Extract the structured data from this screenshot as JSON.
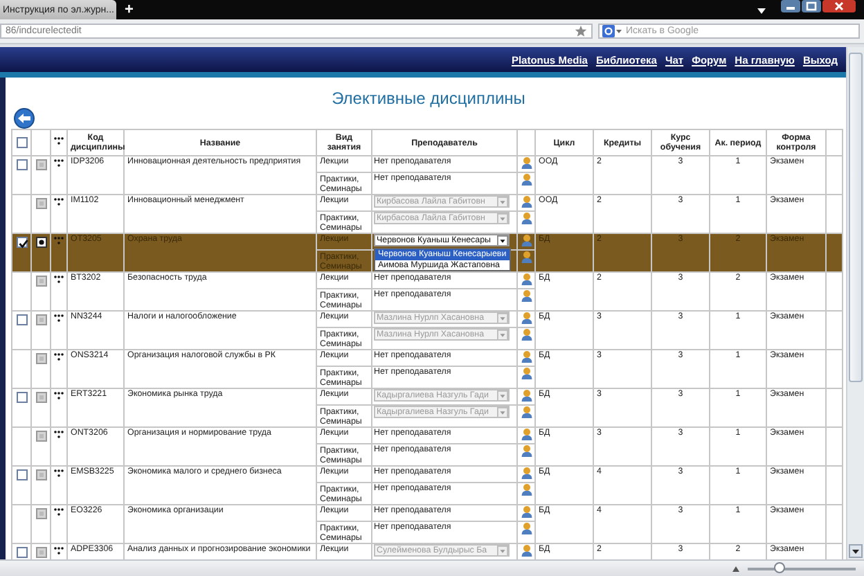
{
  "browser": {
    "tab_title": "Инструкция по эл.журн...",
    "new_tab": "+",
    "address": "86/indcurelectedit",
    "search_placeholder": "Искать в Google"
  },
  "nav": {
    "links": [
      "Platonus Media",
      "Библиотека",
      "Чат",
      "Форум",
      "На главную",
      "Выход"
    ]
  },
  "page_title": "Элективные дисциплины",
  "table": {
    "select_all": {
      "checked": false
    },
    "columns": [
      "Код дисциплины",
      "Название",
      "Вид занятия",
      "Преподаватель",
      "Цикл",
      "Кредиты",
      "Курс обучения",
      "Ак. период",
      "Форма контроля"
    ]
  },
  "disciplines": [
    {
      "checkbox": {
        "checked": false
      },
      "selected": false,
      "code": "IDP3206",
      "name": "Инновационная деятельность предприятия",
      "lessons": [
        {
          "type": "Лекции",
          "teacher": {
            "kind": "none",
            "text": "Нет преподавателя"
          }
        },
        {
          "type": "Практики, Семинары",
          "teacher": {
            "kind": "none",
            "text": "Нет преподавателя"
          }
        }
      ],
      "cycle": "ООД",
      "credits": "2",
      "course": "3",
      "period": "1",
      "control": "Экзамен"
    },
    {
      "selected": false,
      "code": "IM1102",
      "name": "Инновационный менеджмент",
      "lessons": [
        {
          "type": "Лекции",
          "teacher": {
            "kind": "select",
            "value": "Кирбасова Лайла Габитовн",
            "disabled": true
          }
        },
        {
          "type": "Практики, Семинары",
          "teacher": {
            "kind": "select",
            "value": "Кирбасова Лайла Габитовн",
            "disabled": true
          }
        }
      ],
      "cycle": "ООД",
      "credits": "2",
      "course": "3",
      "period": "1",
      "control": "Экзамен"
    },
    {
      "checkbox": {
        "checked": true
      },
      "selected": true,
      "code": "OT3205",
      "name": "Охрана труда",
      "lessons": [
        {
          "type": "Лекции",
          "teacher": {
            "kind": "select",
            "value": "Червонов Куаныш Кенесары",
            "disabled": false,
            "options": [
              {
                "label": "Червонов Куаныш Кенесарыеви",
                "selected": true
              },
              {
                "label": "Аимова Муршида Жастаповна",
                "selected": false
              }
            ]
          }
        },
        {
          "type": "Практики, Семинары"
        }
      ],
      "cycle": "БД",
      "credits": "2",
      "course": "3",
      "period": "2",
      "control": "Экзамен"
    },
    {
      "selected": false,
      "code": "BT3202",
      "name": "Безопасность труда",
      "lessons": [
        {
          "type": "Лекции",
          "teacher": {
            "kind": "none",
            "text": "Нет преподавателя"
          }
        },
        {
          "type": "Практики, Семинары",
          "teacher": {
            "kind": "none",
            "text": "Нет преподавателя"
          }
        }
      ],
      "cycle": "БД",
      "credits": "2",
      "course": "3",
      "period": "2",
      "control": "Экзамен"
    },
    {
      "checkbox": {
        "checked": false
      },
      "selected": false,
      "code": "NN3244",
      "name": "Налоги и налогообложение",
      "lessons": [
        {
          "type": "Лекции",
          "teacher": {
            "kind": "select",
            "value": "Мазлина Нурлп Хасановна",
            "disabled": true
          }
        },
        {
          "type": "Практики, Семинары",
          "teacher": {
            "kind": "select",
            "value": "Мазлина Нурлп Хасановна",
            "disabled": true
          }
        }
      ],
      "cycle": "БД",
      "credits": "3",
      "course": "3",
      "period": "1",
      "control": "Экзамен"
    },
    {
      "selected": false,
      "code": "ONS3214",
      "name": "Организация налоговой службы в РК",
      "lessons": [
        {
          "type": "Лекции",
          "teacher": {
            "kind": "none",
            "text": "Нет преподавателя"
          }
        },
        {
          "type": "Практики, Семинары",
          "teacher": {
            "kind": "none",
            "text": "Нет преподавателя"
          }
        }
      ],
      "cycle": "БД",
      "credits": "3",
      "course": "3",
      "period": "1",
      "control": "Экзамен"
    },
    {
      "checkbox": {
        "checked": false
      },
      "selected": false,
      "code": "ERT3221",
      "name": "Экономика рынка труда",
      "lessons": [
        {
          "type": "Лекции",
          "teacher": {
            "kind": "select",
            "value": "Кадыргалиева Назгуль Гади",
            "disabled": true
          }
        },
        {
          "type": "Практики, Семинары",
          "teacher": {
            "kind": "select",
            "value": "Кадыргалиева Назгуль Гади",
            "disabled": true
          }
        }
      ],
      "cycle": "БД",
      "credits": "3",
      "course": "3",
      "period": "1",
      "control": "Экзамен"
    },
    {
      "selected": false,
      "code": "ONT3206",
      "name": "Организация и нормирование труда",
      "lessons": [
        {
          "type": "Лекции",
          "teacher": {
            "kind": "none",
            "text": "Нет преподавателя"
          }
        },
        {
          "type": "Практики, Семинары",
          "teacher": {
            "kind": "none",
            "text": "Нет преподавателя"
          }
        }
      ],
      "cycle": "БД",
      "credits": "3",
      "course": "3",
      "period": "1",
      "control": "Экзамен"
    },
    {
      "checkbox": {
        "checked": false
      },
      "selected": false,
      "code": "EMSB3225",
      "name": "Экономика малого и среднего бизнеса",
      "lessons": [
        {
          "type": "Лекции",
          "teacher": {
            "kind": "none",
            "text": "Нет преподавателя"
          }
        },
        {
          "type": "Практики, Семинары",
          "teacher": {
            "kind": "none",
            "text": "Нет преподавателя"
          }
        }
      ],
      "cycle": "БД",
      "credits": "4",
      "course": "3",
      "period": "1",
      "control": "Экзамен"
    },
    {
      "selected": false,
      "code": "EO3226",
      "name": "Экономика организации",
      "lessons": [
        {
          "type": "Лекции",
          "teacher": {
            "kind": "none",
            "text": "Нет преподавателя"
          }
        },
        {
          "type": "Практики, Семинары",
          "teacher": {
            "kind": "none",
            "text": "Нет преподавателя"
          }
        }
      ],
      "cycle": "БД",
      "credits": "4",
      "course": "3",
      "period": "1",
      "control": "Экзамен"
    },
    {
      "checkbox": {
        "checked": false
      },
      "selected": false,
      "code": "ADPE3306",
      "name": "Анализ данных и прогнозирование экономики",
      "lessons": [
        {
          "type": "Лекции",
          "teacher": {
            "kind": "select",
            "value": "Сулейменова Булдырыс Ба",
            "disabled": true
          }
        }
      ],
      "cycle": "БД",
      "credits": "2",
      "course": "3",
      "period": "2",
      "control": "Экзамен"
    }
  ],
  "zoom": {
    "level": 0.3
  }
}
